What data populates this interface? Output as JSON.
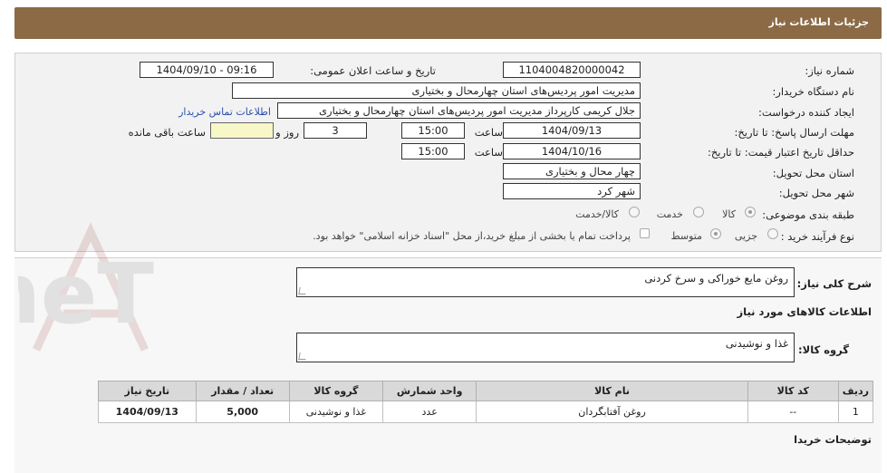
{
  "header": {
    "title": "جزئیات اطلاعات نیاز"
  },
  "form": {
    "need_number": {
      "label": "شماره نیاز:",
      "value": "1104004820000042"
    },
    "announce_datetime": {
      "label": "تاریخ و ساعت اعلان عمومی:",
      "value": "1404/09/10 - 09:16"
    },
    "buyer_org": {
      "label": "نام دستگاه خریدار:",
      "value": "مدیریت امور پردیس‌های استان چهارمحال و بختیاری"
    },
    "requester": {
      "label": "ایجاد کننده درخواست:",
      "value": "جلال کریمی کارپرداز مدیریت امور پردیس‌های استان چهارمحال و بختیاری"
    },
    "contact_link": "اطلاعات تماس خریدار",
    "deadline": {
      "label": "مهلت ارسال پاسخ: تا تاریخ:",
      "date": "1404/09/13",
      "time_label": "ساعت",
      "time": "15:00",
      "days": "3",
      "days_label": "روز و",
      "remaining": "",
      "remaining_label": "ساعت باقی مانده"
    },
    "validity": {
      "label": "حداقل تاریخ اعتبار قیمت: تا تاریخ:",
      "date": "1404/10/16",
      "time_label": "ساعت",
      "time": "15:00"
    },
    "province": {
      "label": "استان محل تحویل:",
      "value": "چهار محال و بختیاری"
    },
    "city": {
      "label": "شهر محل تحویل:",
      "value": "شهر کرد"
    },
    "category": {
      "label": "طبقه بندی موضوعی:",
      "options": [
        "کالا",
        "خدمت",
        "کالا/خدمت"
      ],
      "selected": "کالا"
    },
    "process": {
      "label": "نوع فرآیند خرید :",
      "options": [
        "جزیی",
        "متوسط"
      ],
      "selected": "متوسط",
      "treasury_note": "پرداخت تمام یا بخشی از مبلغ خرید،از محل \"اسناد خزانه اسلامی\" خواهد بود."
    }
  },
  "details": {
    "summary_label": "شرح کلی نیاز:",
    "summary_value": "روغن مایع خوراکی و سرخ کردنی",
    "goods_info_title": "اطلاعات کالاهای مورد نیاز",
    "goods_group_label": "گروه کالا:",
    "goods_group_value": "غذا و نوشیدنی",
    "buyer_notes_label": "توضیحات خریدا"
  },
  "table": {
    "headers": [
      "ردیف",
      "کد کالا",
      "نام کالا",
      "واحد شمارش",
      "گروه کالا",
      "تعداد / مقدار",
      "تاریخ نیاز"
    ],
    "rows": [
      [
        "1",
        "--",
        "روغن آفتابگردان",
        "عدد",
        "غذا و نوشیدنی",
        "5,000",
        "1404/09/13"
      ]
    ]
  },
  "watermark": {
    "text": "AriaTender.neT"
  },
  "colors": {
    "header_bar": "#8b6a45",
    "link": "#2a4fb0",
    "panel_bg": "#f2f2f2"
  }
}
